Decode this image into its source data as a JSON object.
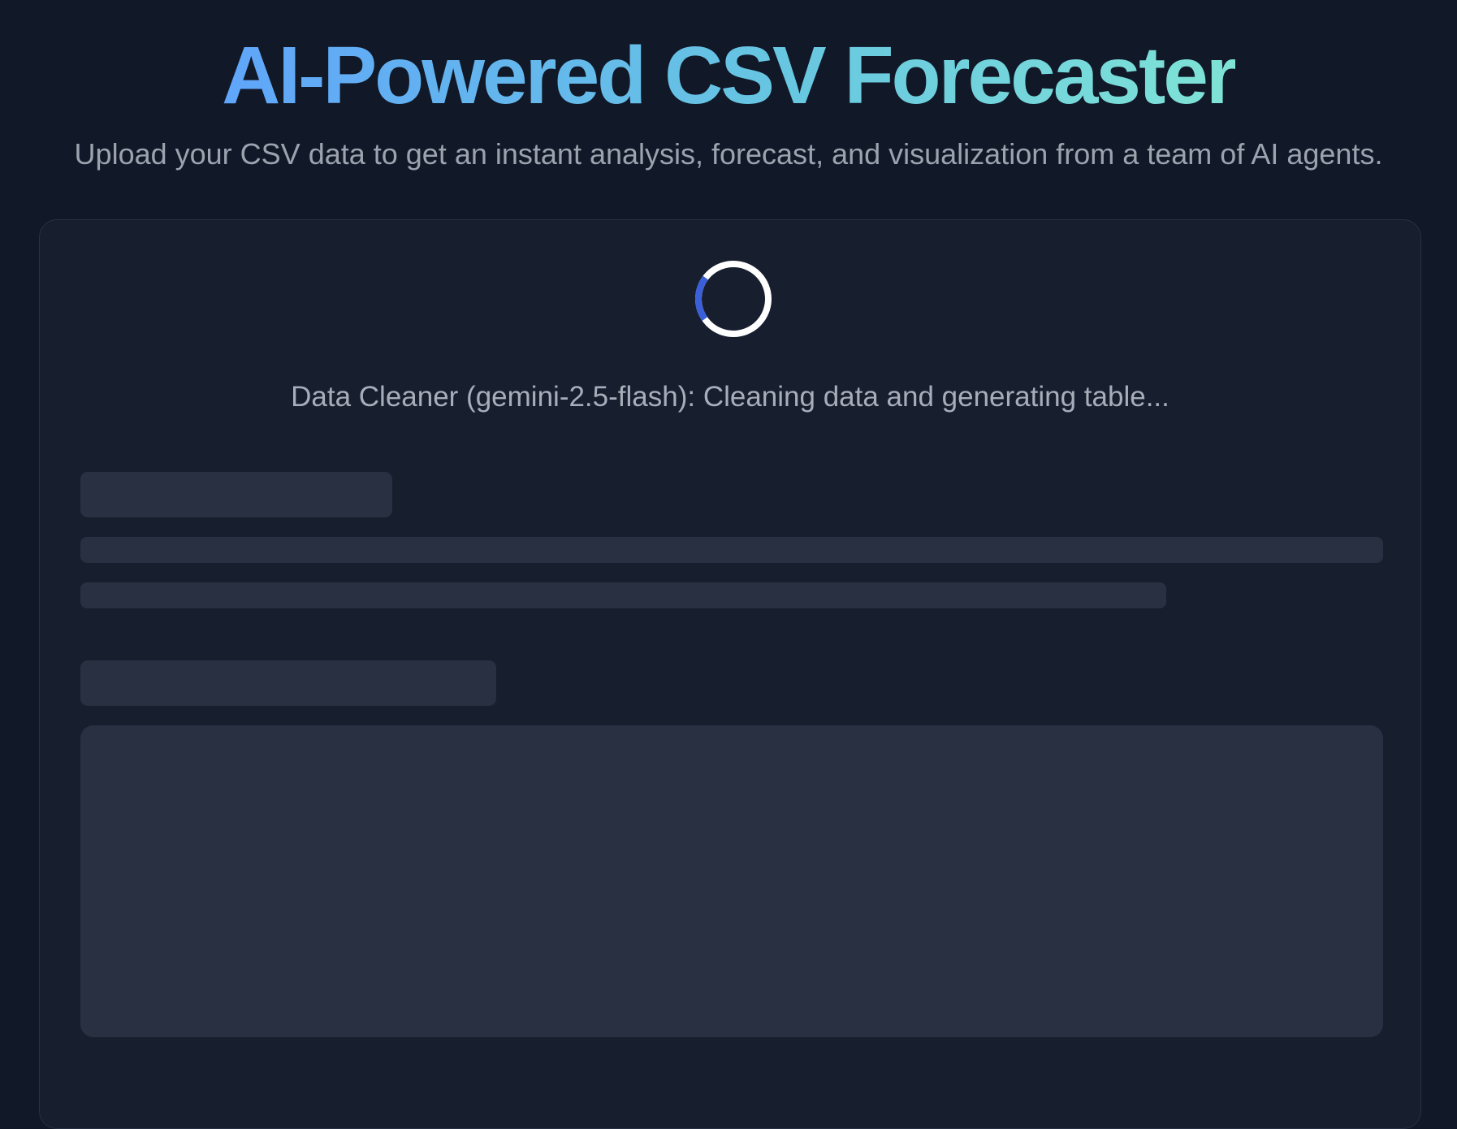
{
  "header": {
    "title": "AI-Powered CSV Forecaster",
    "subtitle": "Upload your CSV data to get an instant analysis, forecast, and visualization from a team of AI agents."
  },
  "loading": {
    "status": "Data Cleaner (gemini-2.5-flash): Cleaning data and generating table...",
    "spinner_icon": "loading-spinner-icon",
    "spinner_progress_fraction": 0.2
  },
  "colors": {
    "background": "#111827",
    "card": "#171e2e",
    "skeleton": "#293041",
    "title_gradient_start": "#60a5fa",
    "title_gradient_end": "#7fe3d6",
    "spinner_track": "#ffffff",
    "spinner_accent": "#3b5fd9"
  }
}
